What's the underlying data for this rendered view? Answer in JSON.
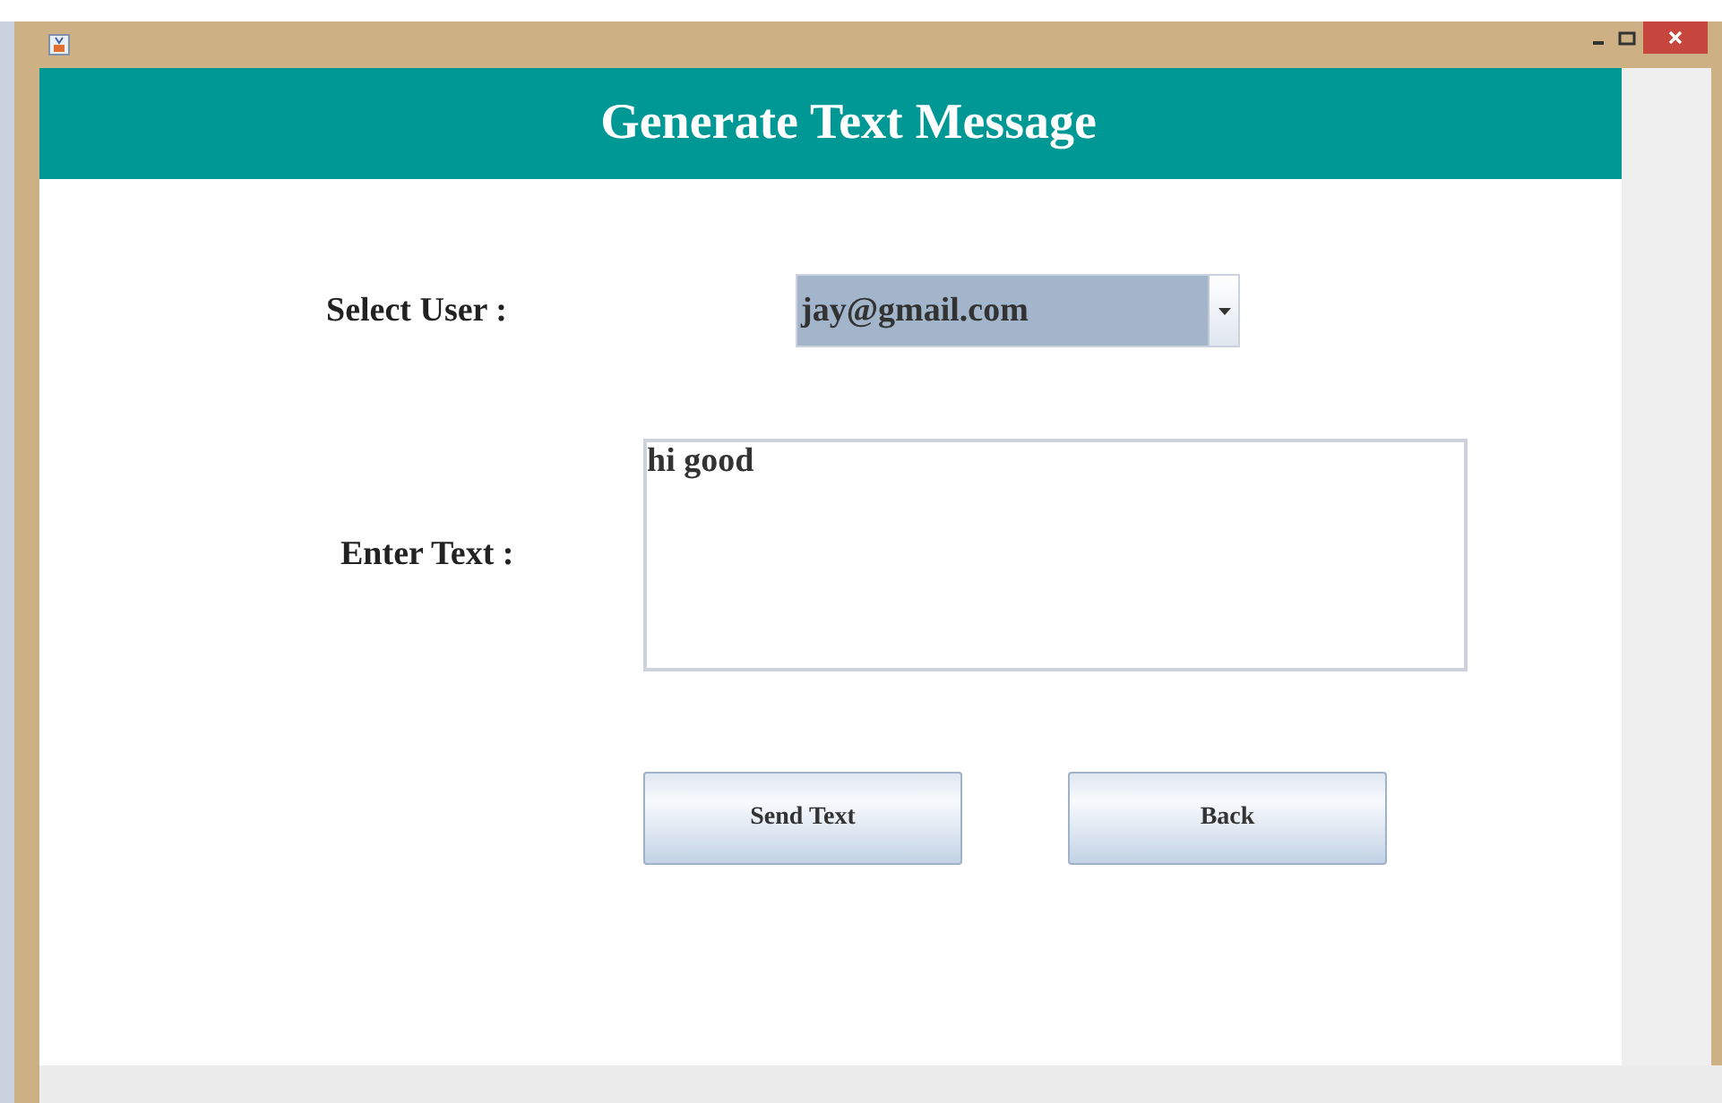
{
  "header": {
    "title": "Generate Text Message"
  },
  "form": {
    "user_label": "Select User :",
    "user_value": "jay@gmail.com",
    "text_label": "Enter Text :",
    "text_value": "hi good"
  },
  "buttons": [
    {
      "label": "Send Text"
    },
    {
      "label": "Back"
    }
  ]
}
